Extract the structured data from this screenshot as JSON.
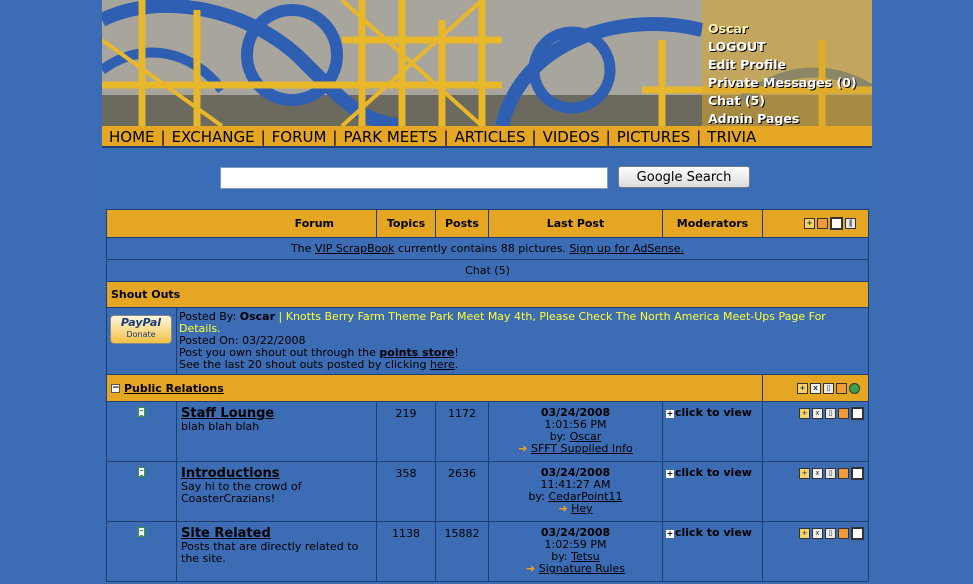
{
  "user_menu": {
    "username": "Oscar",
    "items": [
      "LOGOUT",
      "Edit Profile",
      "Private Messages (0)",
      "Chat (5)",
      "Admin Pages"
    ]
  },
  "nav": [
    "HOME",
    "EXCHANGE",
    "FORUM",
    "PARK MEETS",
    "ARTICLES",
    "VIDEOS",
    "PICTURES",
    "TRIVIA"
  ],
  "search": {
    "value": "",
    "button": "Google Search"
  },
  "table": {
    "headers": {
      "forum": "Forum",
      "topics": "Topics",
      "posts": "Posts",
      "last_post": "Last Post",
      "moderators": "Moderators"
    }
  },
  "scrapbook": {
    "prefix": "The",
    "link": "VIP ScrapBook",
    "middle": "currently contains 88 pictures.",
    "adsense": "Sign up for AdSense."
  },
  "chat_line": "Chat (5)",
  "shoutouts": {
    "title": "Shout Outs",
    "paypal_logo": "PayPal",
    "paypal_sub": "Donate",
    "posted_by_label": "Posted By:",
    "posted_by": "Oscar",
    "pipe": "|",
    "message": "Knotts Berry Farm Theme Park Meet May 4th, Please Check The North America Meet-Ups Page For Details.",
    "posted_on_label": "Posted On:",
    "posted_on": "03/22/2008",
    "line3_a": "Post you own shout out through the",
    "points_store": "points store",
    "line3_b": "!",
    "line4_a": "See the last 20 shout outs posted by clicking",
    "here": "here",
    "line4_b": "."
  },
  "category": {
    "collapse": "−",
    "title": "Public Relations"
  },
  "forums": [
    {
      "name": "Staff Lounge",
      "desc": "blah blah blah",
      "topics": "219",
      "posts": "1172",
      "date": "03/24/2008",
      "time": "1:01:56 PM",
      "by_label": "by:",
      "by": "Oscar",
      "thread": "SFFT Supplied Info",
      "mods": "click to view"
    },
    {
      "name": "Introductions",
      "desc": "Say hi to the crowd of CoasterCrazians!",
      "topics": "358",
      "posts": "2636",
      "date": "03/24/2008",
      "time": "11:41:27 AM",
      "by_label": "by:",
      "by": "CedarPoint11",
      "thread": "Hey",
      "mods": "click to view"
    },
    {
      "name": "Site Related",
      "desc": "Posts that are directly related to the site.",
      "topics": "1138",
      "posts": "15882",
      "date": "03/24/2008",
      "time": "1:02:59 PM",
      "by_label": "by:",
      "by": "Tetsu",
      "thread": "Signature Rules",
      "mods": "click to view"
    }
  ],
  "icons": {
    "header": [
      "new-topic-icon",
      "bookmark-icon",
      "print-icon",
      "subscribe-icon"
    ],
    "category": [
      "new-topic-icon",
      "lock-icon",
      "delete-icon",
      "edit-icon",
      "globe-icon"
    ],
    "row": [
      "new-topic-icon",
      "lock-icon",
      "delete-icon",
      "edit-icon",
      "subscribe-icon"
    ]
  },
  "colors": {
    "page_bg": "#3c6cb4",
    "gold": "#e5a623",
    "coaster_blue": "#2f5fb3",
    "coaster_yellow": "#e8b72a",
    "shout_text": "#ffff33"
  }
}
